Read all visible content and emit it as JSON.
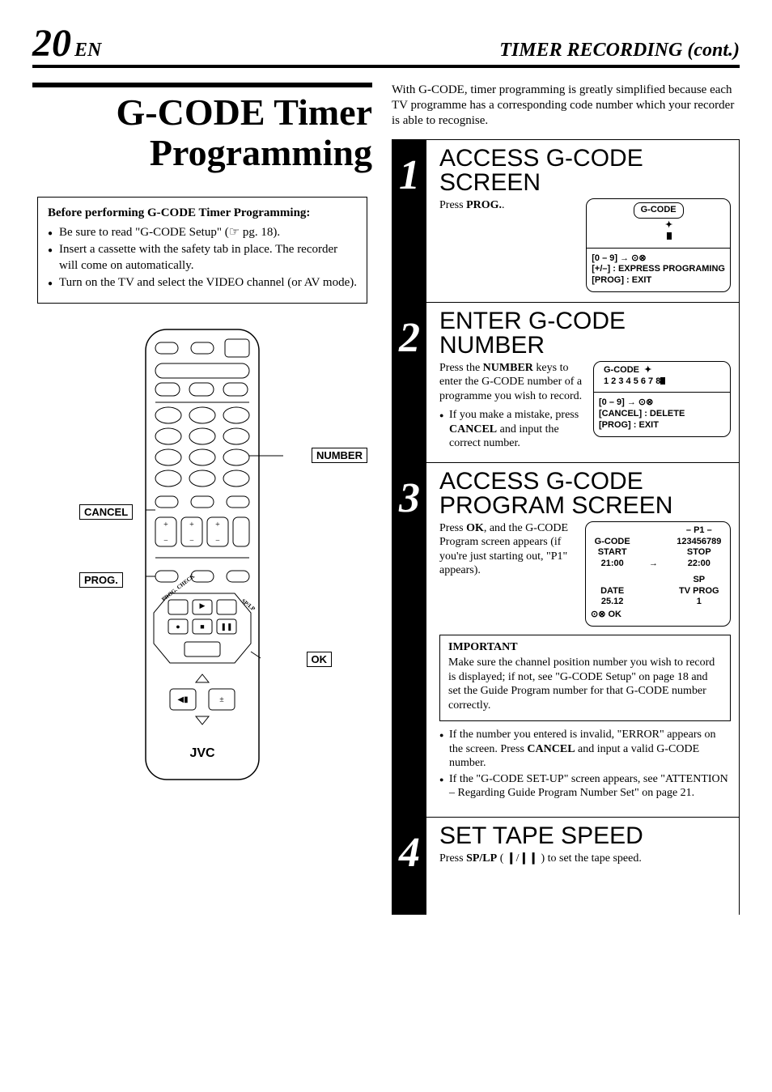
{
  "header": {
    "page_num": "20",
    "lang": "EN",
    "section": "TIMER RECORDING (cont.)"
  },
  "title_seg1": "G-",
  "title_seg2": "CODE",
  "title_seg3": " Timer",
  "title_line2": "Programming",
  "prep": {
    "title_a": "Before performing G-",
    "title_b": "CODE",
    "title_c": " Timer Programming:",
    "items": [
      "Be sure to read \"G-CODE Setup\" (☞ pg. 18).",
      "Insert a cassette with the safety tab in place. The recorder will come on automatically.",
      "Turn on the TV and select the VIDEO channel (or AV mode)."
    ]
  },
  "remote_labels": {
    "number": "NUMBER",
    "cancel": "CANCEL",
    "prog": "PROG.",
    "ok": "OK",
    "brand": "JVC",
    "progcheck": "PROG. CHECK",
    "splp": "SP/LP"
  },
  "intro_a": "With G-",
  "intro_b": "CODE",
  "intro_c": ", timer programming is greatly simplified because each TV programme has a corresponding code number which your recorder is able to recognise.",
  "steps": [
    {
      "num": "1",
      "title": "ACCESS G-CODE SCREEN",
      "body_html": "Press <b>PROG.</b>.",
      "screen": {
        "top_html": "<span class='screen-inner-box'>G-CODE</span><br><span style='display:inline-block;margin-left:26px;'>✦<br><span class='cursor'></span></span>",
        "bottom_lines": [
          "[0 – 9] → ⊙⊗",
          "[+/–] : EXPRESS PROGRAMING",
          "[PROG] : EXIT"
        ]
      }
    },
    {
      "num": "2",
      "title": "ENTER G-CODE NUMBER",
      "body_html": "Press the <b>NUMBER</b> keys to enter the G-<span class='sc'>CODE</span> number of a programme you wish to record.",
      "bullets": [
        "If you make a mistake, press <b>CANCEL</b> and input the correct number."
      ],
      "screen": {
        "top_html": "<div style='text-align:left;padding-left:6px;'><b>G-CODE</b> &nbsp;✦<br><b>1 2 3 4 5 6 7 8</b><span class='cursor'></span></div>",
        "bottom_lines": [
          "[0 – 9] → ⊙⊗",
          "[CANCEL] : DELETE",
          "[PROG] : EXIT"
        ]
      }
    },
    {
      "num": "3",
      "title": "ACCESS G-CODE PROGRAM SCREEN",
      "body_html": "Press <b>OK</b>, and the G-<span class='sc'>CODE</span> Program screen appears (if you're just starting out, \"P1\" appears).",
      "prog_screen": {
        "p": "– P1 –",
        "gcode": "G-CODE",
        "gcode_v": "123456789",
        "start": "START",
        "start_v": "21:00",
        "stop": "STOP",
        "stop_v": "22:00",
        "sp": "SP",
        "date": "DATE",
        "date_v": "25.12",
        "tvprog": "TV PROG",
        "tvprog_v": "1",
        "ok": "⊙⊗ OK"
      },
      "important": {
        "title": "IMPORTANT",
        "text": "Make sure the channel position number you wish to record is displayed; if not, see \"G-CODE Setup\" on page 18 and set the Guide Program number for that G-CODE number correctly."
      },
      "extra_bullets": [
        "If the number you entered is invalid, \"ERROR\" appears on the screen. Press <b>CANCEL</b> and input a valid G-<span class='sc'>CODE</span> number.",
        "If the \"G-CODE SET-UP\" screen appears, see \"ATTENTION – Regarding Guide Program Number Set\" on page 21."
      ]
    },
    {
      "num": "4",
      "title": "SET TAPE SPEED",
      "body_html": "Press <b>SP/LP</b> ( <b>❙</b>/<b>❙❙</b> ) to set the tape speed."
    }
  ]
}
